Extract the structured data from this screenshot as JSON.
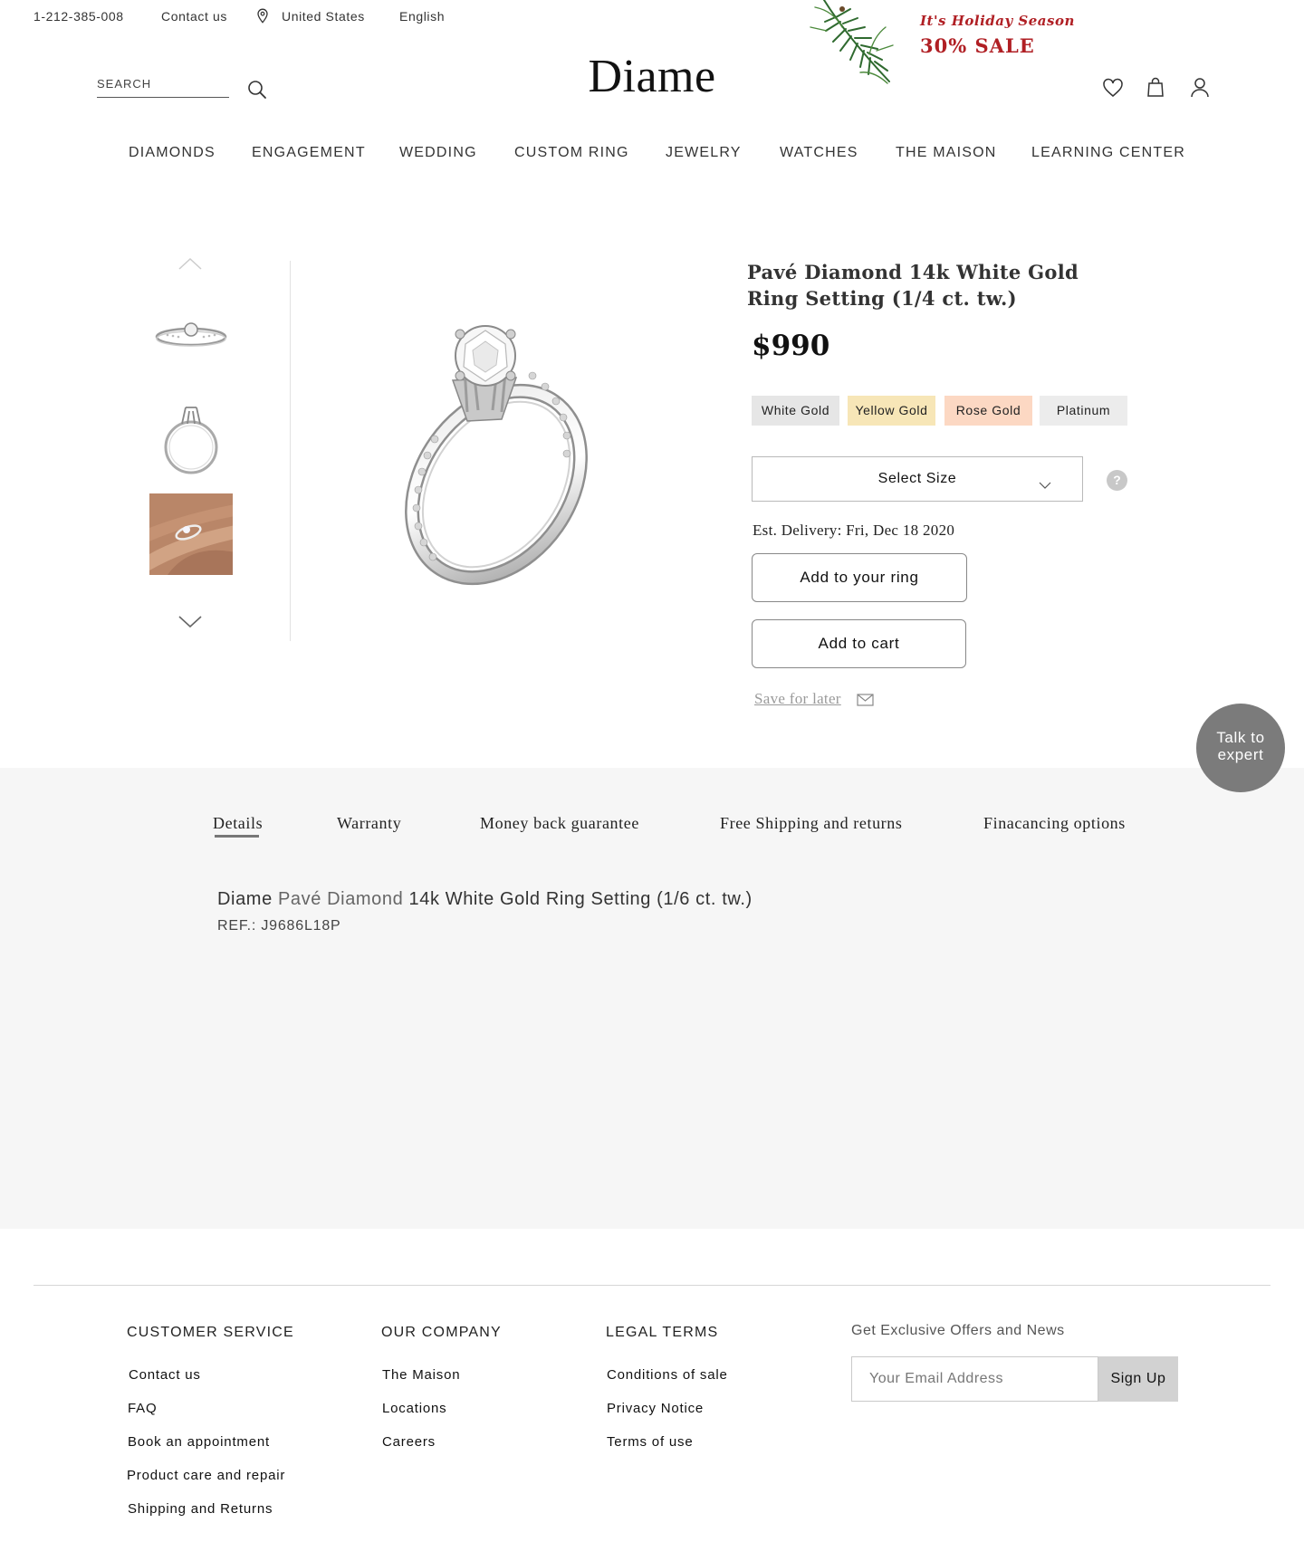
{
  "topbar": {
    "phone": "1-212-385-008",
    "contact": "Contact us",
    "country": "United States",
    "language": "English"
  },
  "holiday": {
    "line1": "It's Holiday Season",
    "line2": "30% SALE",
    "color": "#b01f24"
  },
  "header": {
    "search_placeholder": "SEARCH",
    "logo": "Diame",
    "icons": [
      "wishlist-heart-icon",
      "shopping-bag-icon",
      "account-user-icon"
    ]
  },
  "nav": {
    "items": [
      "DIAMONDS",
      "ENGAGEMENT",
      "WEDDING",
      "CUSTOM RING",
      "JEWELRY",
      "WATCHES",
      "THE MAISON",
      "LEARNING CENTER"
    ]
  },
  "product": {
    "title": "Pavé Diamond 14k White Gold Ring Setting (1/4 ct. tw.)",
    "price": "$990",
    "metals": [
      {
        "label": "White Gold",
        "color": "#e6e6e6"
      },
      {
        "label": "Yellow Gold",
        "color": "#f7e6b7"
      },
      {
        "label": "Rose Gold",
        "color": "#fcd8c3"
      },
      {
        "label": "Platinum",
        "color": "#ececec"
      }
    ],
    "size_label": "Select Size",
    "help": "?",
    "delivery": "Est. Delivery: Fri, Dec 18 2020",
    "add_ring": "Add to your ring",
    "add_cart": "Add to cart",
    "save_later": "Save for later"
  },
  "talk_to_expert": {
    "line1": "Talk to",
    "line2": "expert"
  },
  "details": {
    "tabs": [
      "Details",
      "Warranty",
      "Money back guarantee",
      "Free Shipping and returns",
      "Finacancing options"
    ],
    "name_brand": "Diame",
    "name_highlight": "Pavé Diamond",
    "name_rest": "14k White Gold Ring Setting (1/6 ct. tw.)",
    "ref": "REF.: J9686L18P"
  },
  "footer": {
    "customer_service": {
      "title": "CUSTOMER SERVICE",
      "links": [
        "Contact us",
        "FAQ",
        "Book an appointment",
        "Product care and repair",
        "Shipping and Returns"
      ]
    },
    "our_company": {
      "title": "OUR COMPANY",
      "links": [
        "The Maison",
        "Locations",
        "Careers"
      ]
    },
    "legal_terms": {
      "title": "LEGAL TERMS",
      "links": [
        "Conditions of sale",
        "Privacy Notice",
        "Terms of use"
      ]
    },
    "newsletter": {
      "title": "Get Exclusive Offers and News",
      "email_placeholder": "Your Email Address",
      "signup": "Sign Up"
    }
  }
}
